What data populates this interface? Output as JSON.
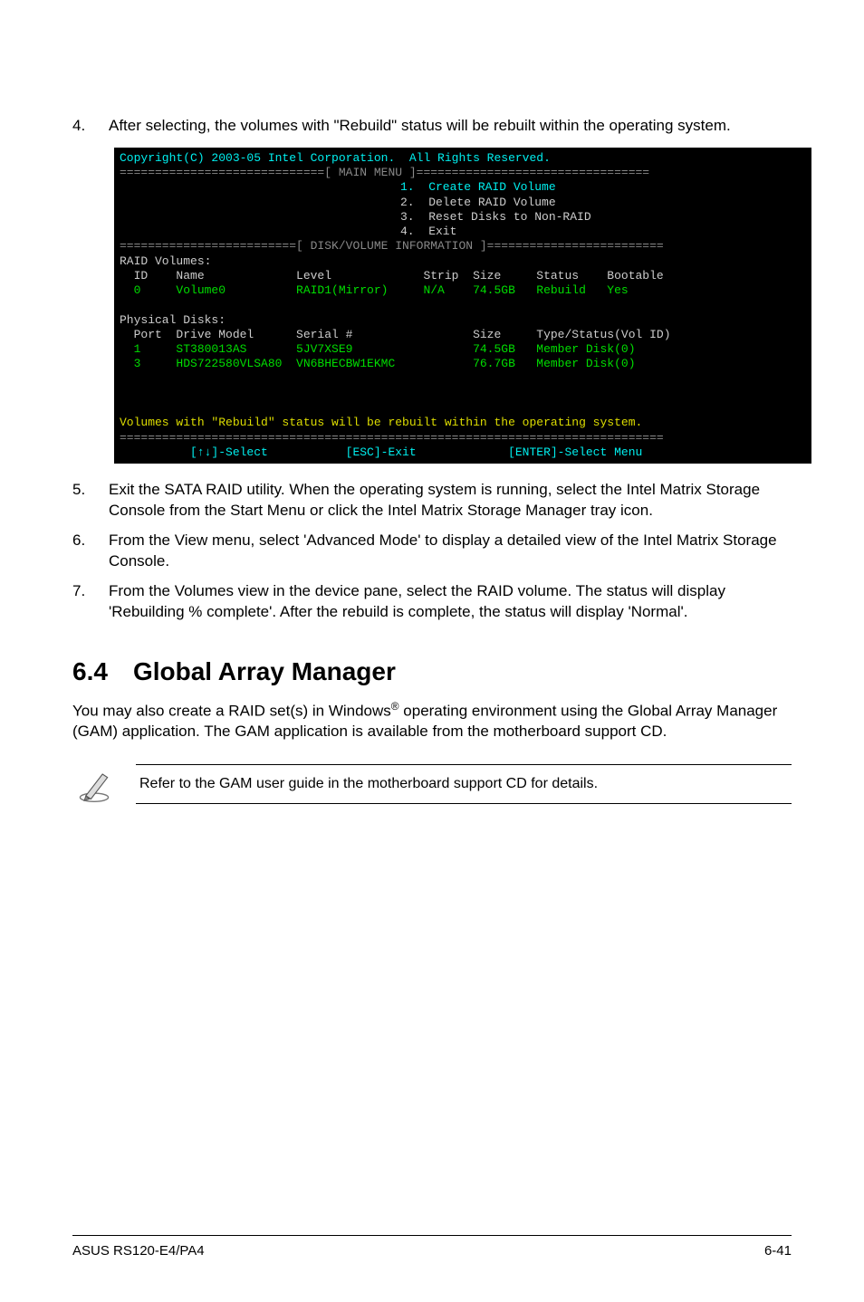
{
  "step4": {
    "num": "4.",
    "text": "After selecting, the volumes with \"Rebuild\" status will be rebuilt within the operating system."
  },
  "terminal": {
    "copyright": "Copyright(C) 2003-05 Intel Corporation.  All Rights Reserved.",
    "main_menu_tag": "=============================[ MAIN MENU ]=================================",
    "menu": {
      "l1": "1.  Create RAID Volume",
      "l2": "2.  Delete RAID Volume",
      "l3": "3.  Reset Disks to Non-RAID",
      "l4": "4.  Exit"
    },
    "info_tag": "=========================[ DISK/VOLUME INFORMATION ]=========================",
    "raid_hdr": "RAID Volumes:",
    "raid_cols": "  ID    Name             Level             Strip  Size     Status    Bootable",
    "raid_row": "  0     Volume0          RAID1(Mirror)     N/A    74.5GB   Rebuild   Yes",
    "phys_hdr": "Physical Disks:",
    "phys_cols": "  Port  Drive Model      Serial #                 Size     Type/Status(Vol ID)",
    "phys_r1": "  1     ST380013AS       5JV7XSE9                 74.5GB   Member Disk(0)",
    "phys_r2": "  3     HDS722580VLSA80  VN6BHECBW1EKMC           76.7GB   Member Disk(0)",
    "message": "Volumes with \"Rebuild\" status will be rebuilt within the operating system.",
    "help": "          [↑↓]-Select           [ESC]-Exit             [ENTER]-Select Menu"
  },
  "step5": {
    "num": "5.",
    "text": "Exit the SATA RAID utility. When the operating system is running, select the Intel Matrix Storage Console from the Start Menu or click the Intel Matrix Storage Manager tray icon."
  },
  "step6": {
    "num": "6.",
    "text": "From the View menu, select 'Advanced Mode' to display a detailed view of the Intel Matrix Storage Console."
  },
  "step7": {
    "num": "7.",
    "text": "From the Volumes view in the device pane, select the RAID volume. The status will display 'Rebuilding % complete'. After the rebuild is complete, the status will display 'Normal'."
  },
  "heading": {
    "num": "6.4",
    "title": "Global Array Manager"
  },
  "para1_a": "You may also create a RAID set(s) in Windows",
  "para1_b": " operating environment using the Global Array Manager (GAM) application. The GAM application is available from the motherboard support CD.",
  "note": "Refer to the GAM user guide in the motherboard support CD for details.",
  "footer": {
    "left": "ASUS RS120-E4/PA4",
    "right": "6-41"
  }
}
